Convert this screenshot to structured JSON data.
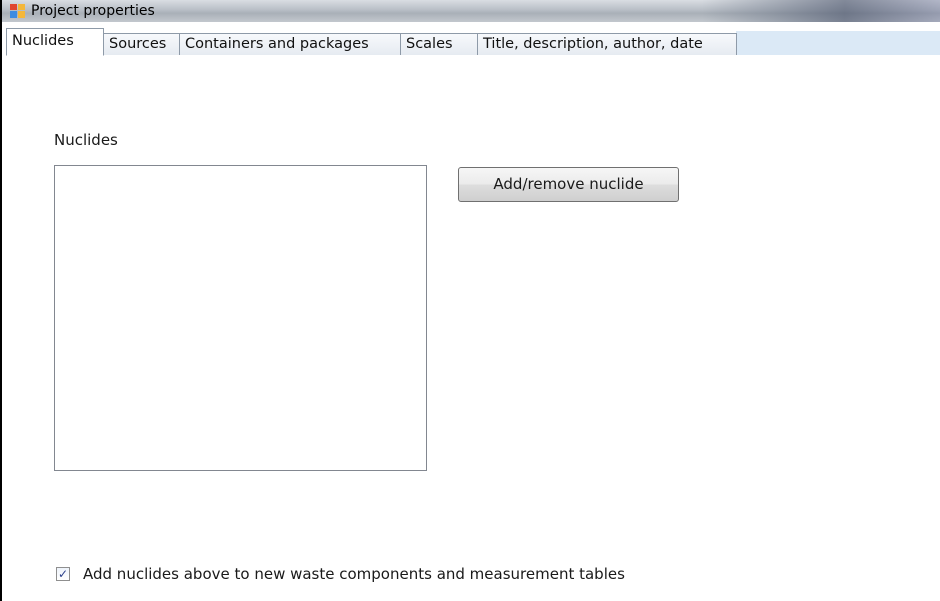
{
  "window": {
    "title": "Project properties",
    "icon": "app-window-icon"
  },
  "tabs": [
    {
      "label": "Nuclides",
      "active": true
    },
    {
      "label": "Sources",
      "active": false
    },
    {
      "label": "Containers and packages",
      "active": false
    },
    {
      "label": "Scales",
      "active": false
    },
    {
      "label": "Title, description, author, date",
      "active": false
    }
  ],
  "nuclides_tab": {
    "group_label": "Nuclides",
    "nuclide_list_items": [],
    "add_remove_button": "Add/remove nuclide",
    "checkbox": {
      "label": "Add nuclides above to new waste components and measurement tables",
      "checked": true
    }
  },
  "colors": {
    "tab_strip_accent": "#dbe9f6",
    "checkmark": "#2b3f8a"
  }
}
